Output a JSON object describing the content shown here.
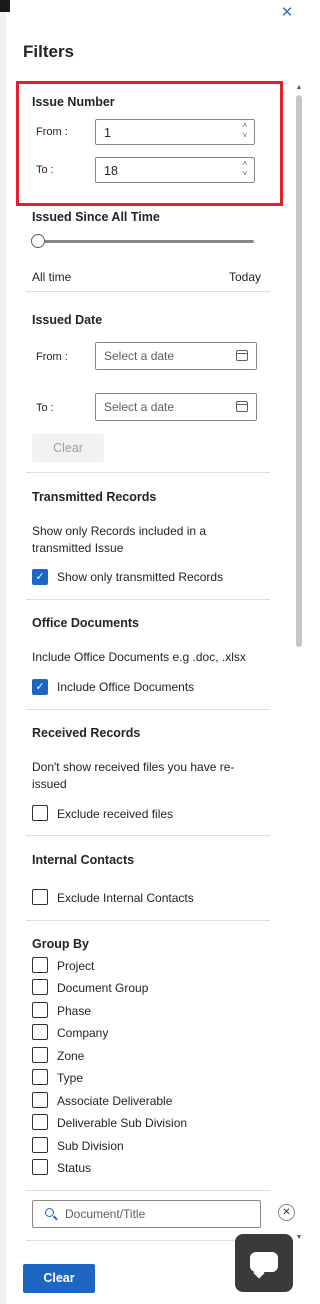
{
  "panel": {
    "title": "Filters",
    "close_icon": "close-icon"
  },
  "issue_number": {
    "title": "Issue Number",
    "from_label": "From :",
    "from_value": "1",
    "to_label": "To :",
    "to_value": "18"
  },
  "issued_since": {
    "title": "Issued Since All Time",
    "min_label": "All time",
    "max_label": "Today",
    "slider_position": 0
  },
  "issued_date": {
    "title": "Issued Date",
    "from_label": "From :",
    "to_label": "To :",
    "from_placeholder": "Select a date",
    "to_placeholder": "Select a date",
    "clear_label": "Clear"
  },
  "transmitted": {
    "title": "Transmitted Records",
    "description": "Show only Records included in a transmitted Issue",
    "checkbox_label": "Show only transmitted Records",
    "checked": true
  },
  "office_docs": {
    "title": "Office Documents",
    "description": "Include Office Documents e.g .doc, .xlsx",
    "checkbox_label": "Include Office Documents",
    "checked": true
  },
  "received": {
    "title": "Received Records",
    "description": "Don't show received files you have re-issued",
    "checkbox_label": "Exclude received files",
    "checked": false
  },
  "internal_contacts": {
    "title": "Internal Contacts",
    "checkbox_label": "Exclude Internal Contacts",
    "checked": false
  },
  "group_by": {
    "title": "Group By",
    "items": [
      "Project",
      "Document Group",
      "Phase",
      "Company",
      "Zone",
      "Type",
      "Associate Deliverable",
      "Deliverable Sub Division",
      "Sub Division",
      "Status"
    ]
  },
  "search": {
    "placeholder": "Document/Title"
  },
  "footer": {
    "clear_label": "Clear"
  },
  "colors": {
    "accent": "#1d67c2",
    "highlight": "#e0202a"
  }
}
